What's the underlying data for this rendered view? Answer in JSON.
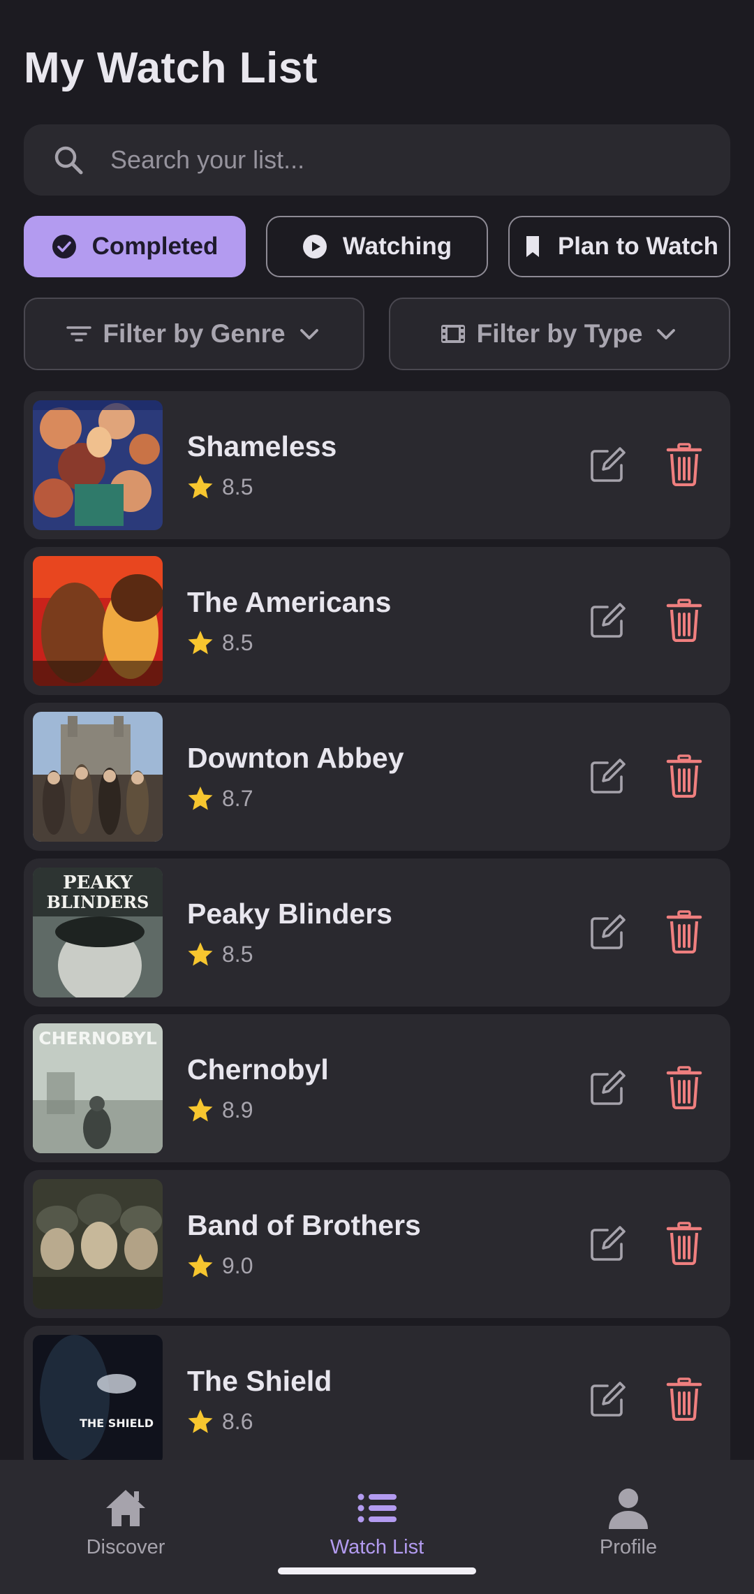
{
  "header": {
    "title": "My Watch List"
  },
  "search": {
    "placeholder": "Search your list...",
    "icon": "search-icon"
  },
  "status_filters": [
    {
      "label": "Completed",
      "icon": "check-circle-icon",
      "active": true
    },
    {
      "label": "Watching",
      "icon": "play-circle-icon",
      "active": false
    },
    {
      "label": "Plan to Watch",
      "icon": "bookmark-icon",
      "active": false
    }
  ],
  "dropdowns": {
    "genre": {
      "label": "Filter by Genre",
      "icon": "filter-lines-icon"
    },
    "type": {
      "label": "Filter by Type",
      "icon": "film-icon"
    }
  },
  "items": [
    {
      "title": "Shameless",
      "rating": "8.5",
      "poster": "Shameless"
    },
    {
      "title": "The Americans",
      "rating": "8.5",
      "poster": "The Americans"
    },
    {
      "title": "Downton Abbey",
      "rating": "8.7",
      "poster": "Downton Abbey"
    },
    {
      "title": "Peaky Blinders",
      "rating": "8.5",
      "poster": "Peaky Blinders"
    },
    {
      "title": "Chernobyl",
      "rating": "8.9",
      "poster": "Chernobyl"
    },
    {
      "title": "Band of Brothers",
      "rating": "9.0",
      "poster": "Band of Brothers"
    },
    {
      "title": "The Shield",
      "rating": "8.6",
      "poster": "The Shield"
    }
  ],
  "poster_text": {
    "peaky_line1": "PEAKY",
    "peaky_line2": "BLINDERS",
    "chernobyl": "CHERNOBYL",
    "shield": "THE SHIELD"
  },
  "bottom_nav": [
    {
      "label": "Discover",
      "icon": "home-icon",
      "active": false
    },
    {
      "label": "Watch List",
      "icon": "list-icon",
      "active": true
    },
    {
      "label": "Profile",
      "icon": "person-icon",
      "active": false
    }
  ],
  "colors": {
    "background": "#1c1b21",
    "surface": "#2a292f",
    "accent": "#b39bf0",
    "delete": "#ef7f7f",
    "star": "#f7c62f"
  }
}
